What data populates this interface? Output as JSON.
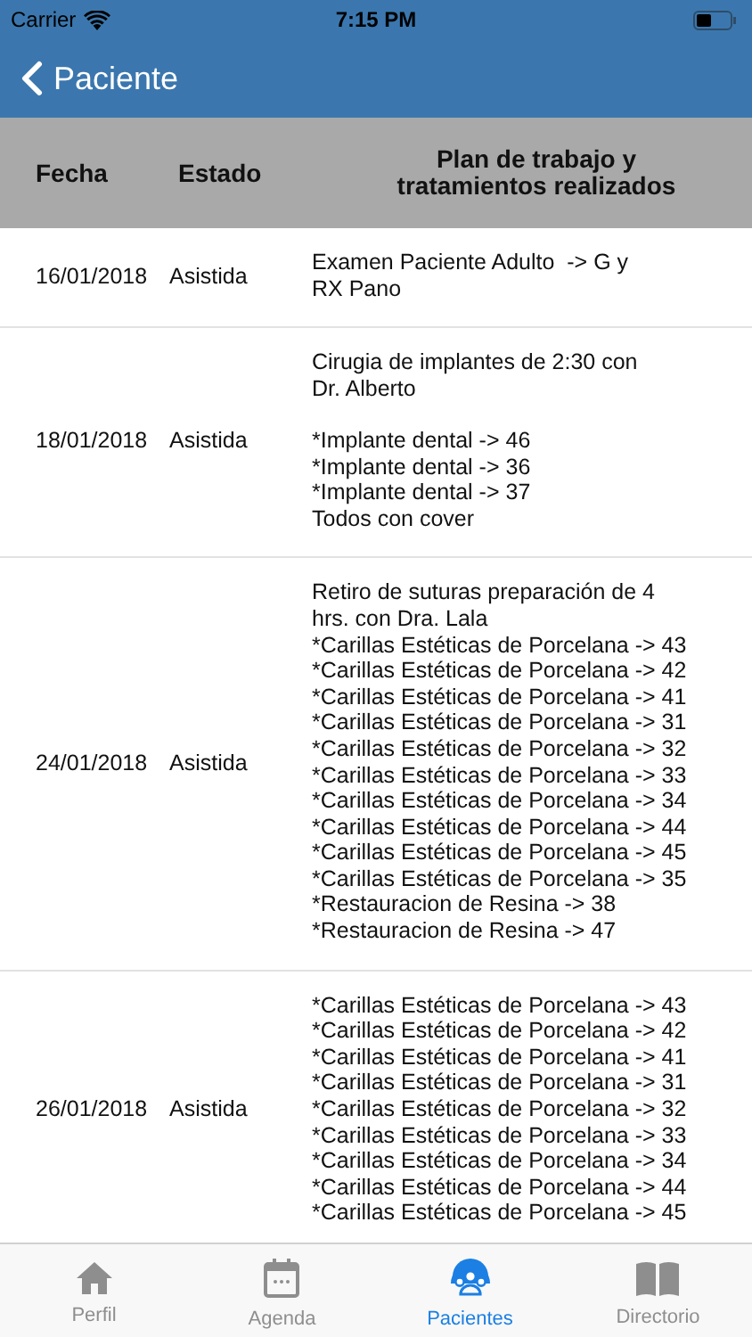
{
  "status_bar": {
    "carrier": "Carrier",
    "time": "7:15 PM"
  },
  "nav": {
    "back_label": "Paciente"
  },
  "table": {
    "columns": [
      "Fecha",
      "Estado",
      "Plan de trabajo y\ntratamientos realizados"
    ],
    "rows": [
      {
        "date": "16/01/2018",
        "status": "Asistida",
        "plan": [
          [
            "Examen Paciente Adulto  -> G y\nRX Pano"
          ]
        ]
      },
      {
        "date": "18/01/2018",
        "status": "Asistida",
        "plan": [
          [
            "Cirugia de implantes de 2:30 con\nDr. Alberto"
          ],
          [
            "*Implante dental -> 46",
            "*Implante dental -> 36",
            "*Implante dental -> 37",
            "Todos con cover"
          ]
        ]
      },
      {
        "date": "24/01/2018",
        "status": "Asistida",
        "plan": [
          [
            "Retiro de suturas preparación de 4\nhrs. con Dra. Lala",
            "*Carillas Estéticas de Porcelana -> 43",
            "*Carillas Estéticas de Porcelana -> 42",
            "*Carillas Estéticas de Porcelana -> 41",
            "*Carillas Estéticas de Porcelana -> 31",
            "*Carillas Estéticas de Porcelana -> 32",
            "*Carillas Estéticas de Porcelana -> 33",
            "*Carillas Estéticas de Porcelana -> 34",
            "*Carillas Estéticas de Porcelana -> 44",
            "*Carillas Estéticas de Porcelana -> 45",
            "*Carillas Estéticas de Porcelana -> 35",
            "*Restauracion de Resina -> 38",
            "*Restauracion de Resina -> 47"
          ]
        ]
      },
      {
        "date": "26/01/2018",
        "status": "Asistida",
        "plan": [
          [
            "*Carillas Estéticas de Porcelana -> 43",
            "*Carillas Estéticas de Porcelana -> 42",
            "*Carillas Estéticas de Porcelana -> 41",
            "*Carillas Estéticas de Porcelana -> 31",
            "*Carillas Estéticas de Porcelana -> 32",
            "*Carillas Estéticas de Porcelana -> 33",
            "*Carillas Estéticas de Porcelana -> 34",
            "*Carillas Estéticas de Porcelana -> 44",
            "*Carillas Estéticas de Porcelana -> 45"
          ]
        ]
      }
    ]
  },
  "tab_bar": [
    {
      "kind": "home",
      "label": "Perfil",
      "selected": false
    },
    {
      "kind": "calendar",
      "label": "Agenda",
      "selected": false
    },
    {
      "kind": "people",
      "label": "Pacientes",
      "selected": true
    },
    {
      "kind": "book",
      "label": "Directorio",
      "selected": false
    }
  ]
}
